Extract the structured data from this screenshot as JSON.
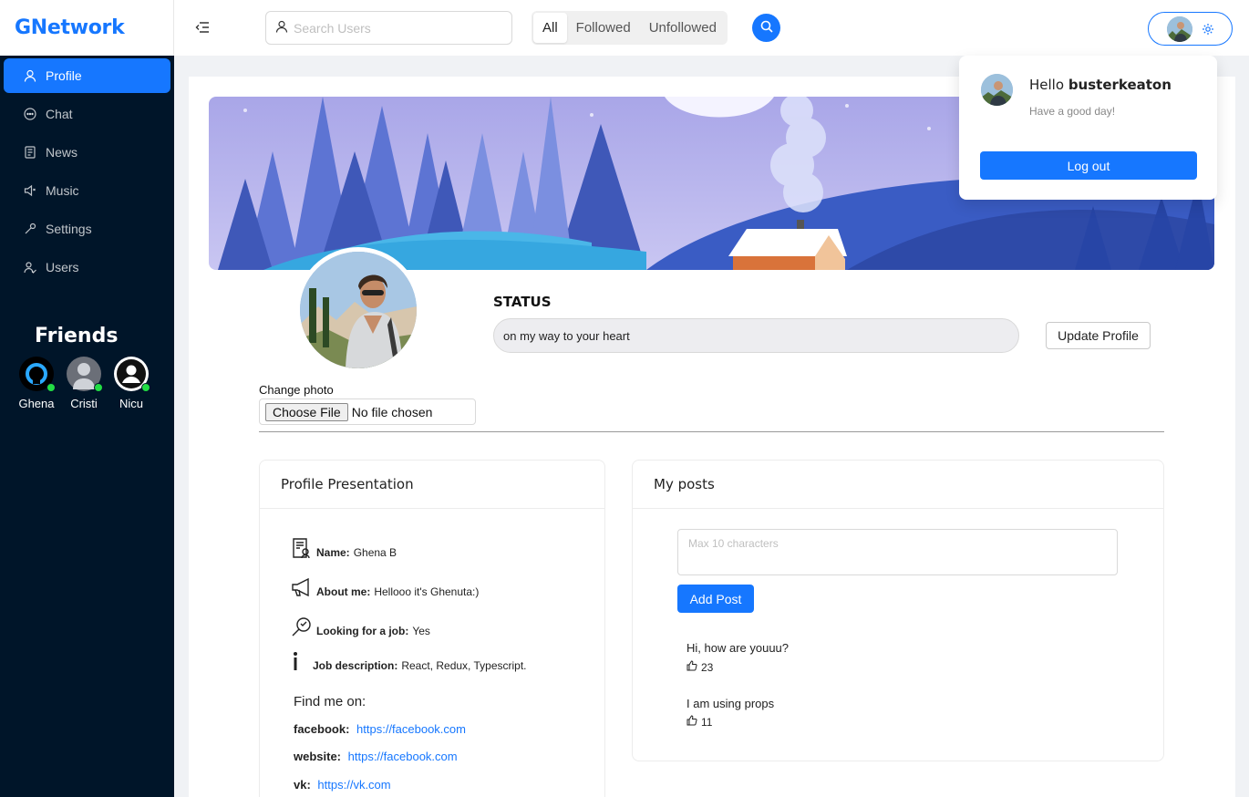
{
  "app": {
    "logo": "GNetwork"
  },
  "sidebar": {
    "items": [
      {
        "label": "Profile",
        "icon": "user-icon",
        "active": true
      },
      {
        "label": "Chat",
        "icon": "chat-icon"
      },
      {
        "label": "News",
        "icon": "news-icon"
      },
      {
        "label": "Music",
        "icon": "sound-icon"
      },
      {
        "label": "Settings",
        "icon": "tool-icon"
      },
      {
        "label": "Users",
        "icon": "users-icon"
      }
    ],
    "friends_title": "Friends",
    "friends": [
      {
        "name": "Ghena",
        "online": true
      },
      {
        "name": "Cristi",
        "online": true
      },
      {
        "name": "Nicu",
        "online": true
      }
    ]
  },
  "header": {
    "search_placeholder": "Search Users",
    "filters": [
      "All",
      "Followed",
      "Unfollowed"
    ],
    "active_filter": "All"
  },
  "dropdown": {
    "hello": "Hello",
    "username": "busterkeaton",
    "subtitle": "Have a good day!",
    "logout": "Log out"
  },
  "profile": {
    "status_label": "STATUS",
    "status_text": "on my way to your heart",
    "update_button": "Update Profile",
    "change_photo": "Change photo",
    "choose_file": "Choose File",
    "no_file": "No file chosen"
  },
  "presentation": {
    "title": "Profile Presentation",
    "name_label": "Name:",
    "name_value": "Ghena B",
    "about_label": "About me:",
    "about_value": "Hellooo it's Ghenuta:)",
    "job_label": "Looking for a job:",
    "job_value": "Yes",
    "desc_label": "Job description:",
    "desc_value": "React, Redux, Typescript.",
    "find_me": "Find me on:",
    "links": [
      {
        "label": "facebook:",
        "url": "https://facebook.com"
      },
      {
        "label": "website:",
        "url": "https://facebook.com"
      },
      {
        "label": "vk:",
        "url": "https://vk.com"
      }
    ]
  },
  "posts": {
    "title": "My posts",
    "placeholder": "Max 10 characters",
    "add_button": "Add Post",
    "items": [
      {
        "text": "Hi, how are youuu?",
        "likes": "23"
      },
      {
        "text": "I am using props",
        "likes": "11"
      }
    ]
  },
  "colors": {
    "primary": "#1677ff",
    "sidebar": "#001529",
    "online": "#22dd44"
  }
}
